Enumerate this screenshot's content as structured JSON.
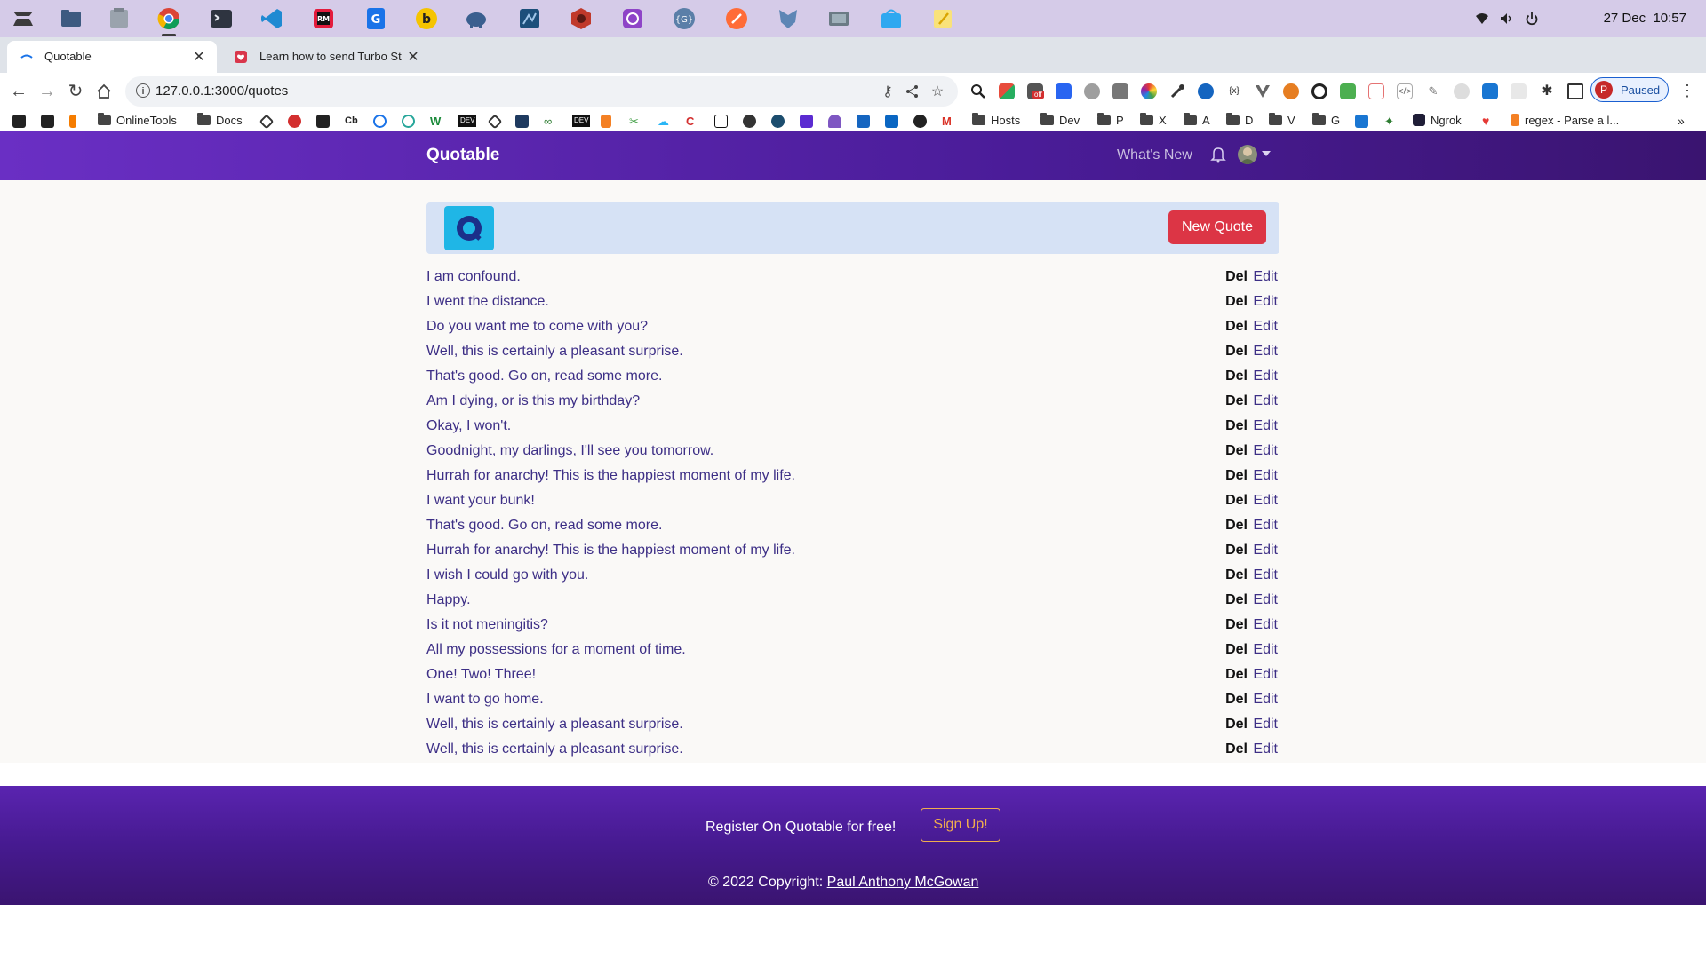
{
  "os": {
    "date": "27 Dec",
    "time": "10:57",
    "icons": [
      "zorin-menu-icon",
      "files-icon",
      "files-icon",
      "chrome-icon",
      "terminal-icon",
      "vscode-icon",
      "rubymine-icon",
      "g-app-icon",
      "b-app-icon",
      "elephant-icon",
      "mysql-icon",
      "redis-icon",
      "github-icon",
      "g-circle-icon",
      "postman-icon",
      "dbeaver-icon",
      "screen-icon",
      "store-icon",
      "notes-icon"
    ],
    "status_icons": [
      "wifi-icon",
      "volume-icon",
      "power-icon"
    ]
  },
  "browser": {
    "tabs": [
      {
        "title": "Quotable",
        "active": true
      },
      {
        "title": "Learn how to send Turbo St",
        "active": false
      }
    ],
    "url": "127.0.0.1:3000/quotes",
    "profile_initial": "P",
    "profile_status": "Paused",
    "bookmarks": [
      {
        "label": "OnlineTools",
        "type": "folder"
      },
      {
        "label": "Docs",
        "type": "folder"
      },
      {
        "label": "Cb",
        "type": "icon"
      },
      {
        "label": "DEV",
        "type": "icon"
      },
      {
        "label": "DEV",
        "type": "icon"
      },
      {
        "label": "Hosts",
        "type": "folder"
      },
      {
        "label": "Dev",
        "type": "folder"
      },
      {
        "label": "P",
        "type": "folder"
      },
      {
        "label": "X",
        "type": "folder"
      },
      {
        "label": "A",
        "type": "folder"
      },
      {
        "label": "D",
        "type": "folder"
      },
      {
        "label": "V",
        "type": "folder"
      },
      {
        "label": "G",
        "type": "folder"
      },
      {
        "label": "Ngrok",
        "type": "icon"
      },
      {
        "label": "regex - Parse a l...",
        "type": "icon"
      }
    ]
  },
  "app": {
    "brand": "Quotable",
    "whats_new": "What's New",
    "new_quote": "New Quote",
    "logo_letter": "Q",
    "quotes": [
      "I am confound.",
      "I went the distance.",
      "Do you want me to come with you?",
      "Well, this is certainly a pleasant surprise.",
      "That's good. Go on, read some more.",
      "Am I dying, or is this my birthday?",
      "Okay, I won't.",
      "Goodnight, my darlings, I'll see you tomorrow.",
      "Hurrah for anarchy! This is the happiest moment of my life.",
      "I want your bunk!",
      "That's good. Go on, read some more.",
      "Hurrah for anarchy! This is the happiest moment of my life.",
      "I wish I could go with you.",
      "Happy.",
      "Is it not meningitis?",
      "All my possessions for a moment of time.",
      "One! Two! Three!",
      "I want to go home.",
      "Well, this is certainly a pleasant surprise.",
      "Well, this is certainly a pleasant surprise."
    ],
    "del_label": "Del",
    "edit_label": "Edit"
  },
  "footer": {
    "register_text": "Register On Quotable for free!",
    "signup": "Sign Up!",
    "copyright": "© 2022 Copyright: ",
    "author": "Paul Anthony McGowan"
  },
  "colors": {
    "navbar": "#4a1c98",
    "banner": "#d6e2f5",
    "danger": "#dc3545",
    "warning": "#f0ad4e",
    "quote_text": "#3d2f86"
  }
}
